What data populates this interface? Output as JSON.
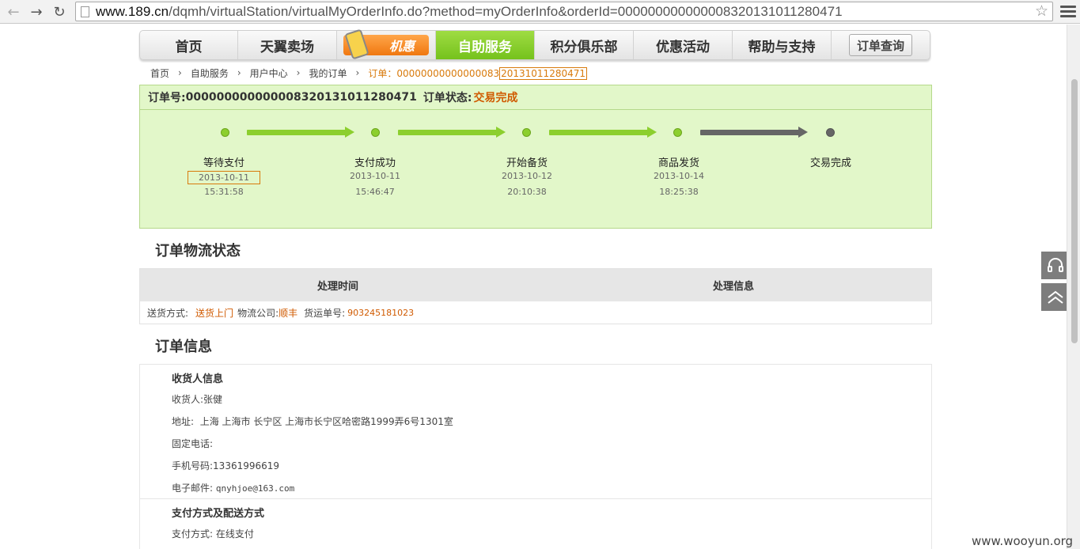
{
  "browser": {
    "url_host": "www.189.cn",
    "url_path": "/dqmh/virtualStation/virtualMyOrderInfo.do?method=myOrderInfo&orderId=000000000000008320131011280471"
  },
  "nav": {
    "items": [
      "首页",
      "天翼卖场",
      "机惠",
      "自助服务",
      "积分俱乐部",
      "优惠活动",
      "帮助与支持"
    ],
    "order_query": "订单查询",
    "active_color": "#8acb2a"
  },
  "breadcrumb": {
    "items": [
      "首页",
      "自助服务",
      "用户中心",
      "我的订单"
    ],
    "current_prefix": "订单：00000000000000083",
    "current_highlight": "20131011280471"
  },
  "order": {
    "number_label": "订单号:",
    "number": "000000000000008320131011280471",
    "status_label": "订单状态:",
    "status": "交易完成",
    "steps": [
      {
        "name": "等待支付",
        "date": "2013-10-11",
        "time": "15:31:58"
      },
      {
        "name": "支付成功",
        "date": "2013-10-11",
        "time": "15:46:47"
      },
      {
        "name": "开始备货",
        "date": "2013-10-12",
        "time": "20:10:38"
      },
      {
        "name": "商品发货",
        "date": "2013-10-14",
        "time": "18:25:38"
      },
      {
        "name": "交易完成",
        "date": "",
        "time": ""
      }
    ]
  },
  "logistics": {
    "title": "订单物流状态",
    "col_time": "处理时间",
    "col_info": "处理信息",
    "delivery_label": "送货方式:",
    "delivery_value": "送货上门",
    "company_label": "物流公司:",
    "company_value": "顺丰",
    "tracking_label": "货运单号:",
    "tracking_value": "903245181023"
  },
  "info": {
    "title": "订单信息",
    "receiver_section": "收货人信息",
    "receiver": "收货人:张健",
    "address_label": "地址:",
    "address": "上海  上海市  长宁区  上海市长宁区哈密路1999弄6号1301室",
    "phone": "固定电话:",
    "mobile": "手机号码:13361996619",
    "email_label": "电子邮件:",
    "email": "qnyhjoe@163.com",
    "payment_section": "支付方式及配送方式",
    "payment": "支付方式: 在线支付"
  },
  "watermark": "www.wooyun.org"
}
